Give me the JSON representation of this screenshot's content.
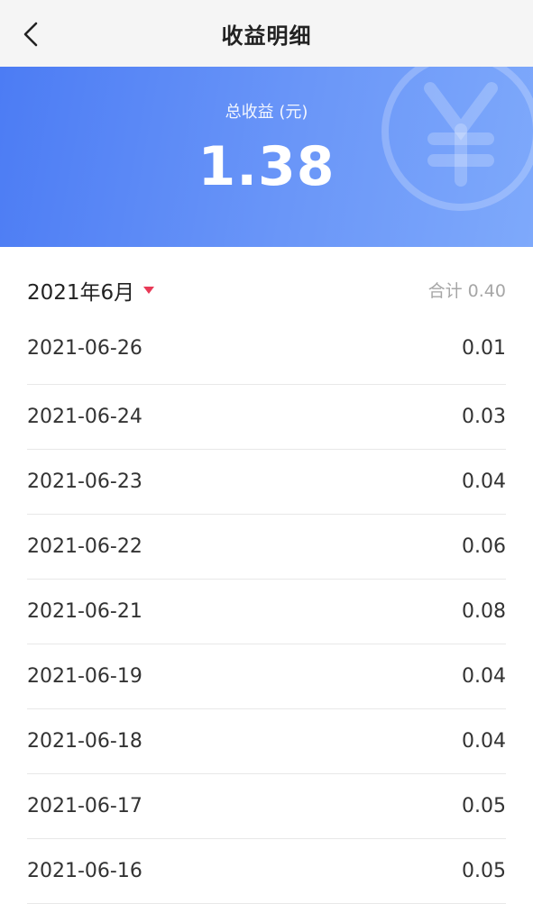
{
  "header": {
    "title": "收益明细"
  },
  "summary": {
    "label": "总收益 (元)",
    "value": "1.38"
  },
  "month": {
    "label": "2021年6月",
    "total_label": "合计 0.40"
  },
  "colors": {
    "banner_start": "#4c7cf4",
    "banner_end": "#7ea9fb",
    "caret": "#e83a57"
  },
  "icons": {
    "back": "chevron-left-icon",
    "decoration": "yuan-icon",
    "dropdown": "caret-down-icon"
  },
  "records": [
    {
      "date": "2021-06-26",
      "amount": "0.01"
    },
    {
      "date": "2021-06-24",
      "amount": "0.03"
    },
    {
      "date": "2021-06-23",
      "amount": "0.04"
    },
    {
      "date": "2021-06-22",
      "amount": "0.06"
    },
    {
      "date": "2021-06-21",
      "amount": "0.08"
    },
    {
      "date": "2021-06-19",
      "amount": "0.04"
    },
    {
      "date": "2021-06-18",
      "amount": "0.04"
    },
    {
      "date": "2021-06-17",
      "amount": "0.05"
    },
    {
      "date": "2021-06-16",
      "amount": "0.05"
    }
  ]
}
